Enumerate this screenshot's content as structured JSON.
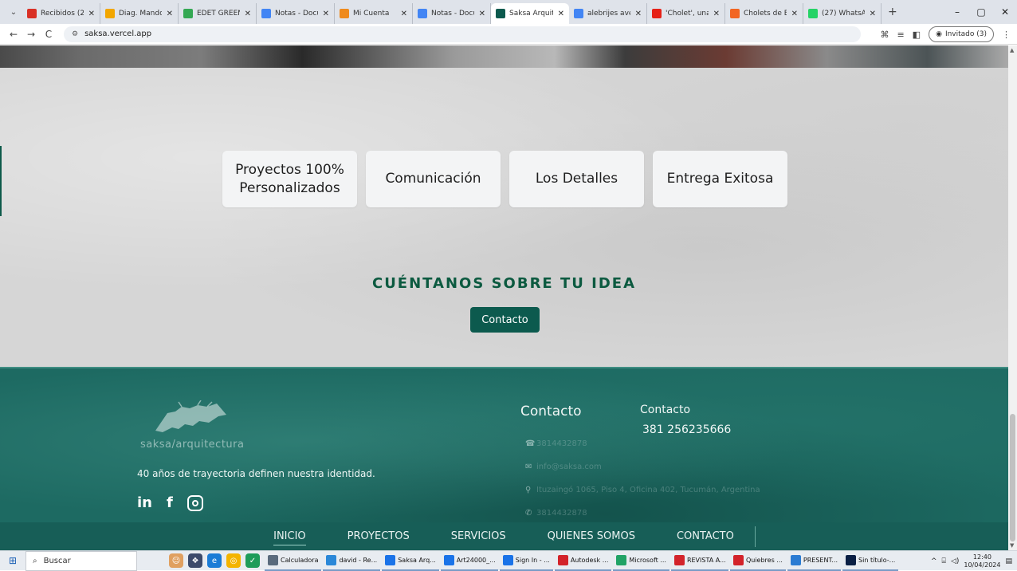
{
  "browser": {
    "tabs": [
      {
        "title": "Recibidos (2)",
        "favicon_color": "#d93025"
      },
      {
        "title": "Diag. Mandoq",
        "favicon_color": "#f2a600"
      },
      {
        "title": "EDET GREEN",
        "favicon_color": "#34a853"
      },
      {
        "title": "Notas - Docum",
        "favicon_color": "#4285f4"
      },
      {
        "title": "Mi Cuenta",
        "favicon_color": "#ef8a1c"
      },
      {
        "title": "Notas - Docum",
        "favicon_color": "#4285f4"
      },
      {
        "title": "Saksa Arquitec",
        "favicon_color": "#0c5a4e",
        "active": true
      },
      {
        "title": "alebrijes aveni",
        "favicon_color": "#4285f4"
      },
      {
        "title": "'Cholet', una m",
        "favicon_color": "#e62117"
      },
      {
        "title": "Cholets de El A",
        "favicon_color": "#f26522"
      },
      {
        "title": "(27) WhatsApp",
        "favicon_color": "#25d366"
      }
    ],
    "new_tab_symbol": "+",
    "window_controls": {
      "minimize": "–",
      "maximize": "▢",
      "close": "✕"
    },
    "nav": {
      "back": "←",
      "forward": "→",
      "reload": "C"
    },
    "url": "saksa.vercel.app",
    "profile_label": "Invitado (3)"
  },
  "page": {
    "features": [
      "Proyectos 100% Personalizados",
      "Comunicación",
      "Los Detalles",
      "Entrega Exitosa"
    ],
    "cta_title": "CUÉNTANOS SOBRE TU IDEA",
    "cta_button": "Contacto",
    "footer": {
      "logo_text": "saksa/arquitectura",
      "tagline": "40 años de trayectoria definen nuestra identidad.",
      "social": [
        "linkedin-icon",
        "facebook-icon",
        "instagram-icon"
      ],
      "social_labels": {
        "linkedin": "in",
        "facebook": "f"
      },
      "contact_heading": "Contacto",
      "contact_items": [
        {
          "icon": "phone-icon",
          "glyph": "☎",
          "text": "3814432878"
        },
        {
          "icon": "mail-icon",
          "glyph": "✉",
          "text": "info@saksa.com"
        },
        {
          "icon": "location-icon",
          "glyph": "⚲",
          "text": "Ituzaingó 1065, Piso 4, Oficina 402, Tucumán, Argentina"
        },
        {
          "icon": "whatsapp-icon",
          "glyph": "✆",
          "text": "3814432878"
        }
      ],
      "contact_heading_2": "Contacto",
      "contact_phone": "381 256235666",
      "nav": [
        "INICIO",
        "PROYECTOS",
        "SERVICIOS",
        "QUIENES SOMOS",
        "CONTACTO"
      ],
      "nav_active": "INICIO"
    }
  },
  "taskbar": {
    "start_icon": "⊞",
    "search_placeholder": "Buscar",
    "apps": [
      {
        "label": "Calculadora",
        "color": "#5a6b7d"
      },
      {
        "label": "david - Re...",
        "color": "#2b88d8"
      },
      {
        "label": "Saksa Arq...",
        "color": "#1a73e8"
      },
      {
        "label": "Art24000_...",
        "color": "#1a73e8"
      },
      {
        "label": "Sign In - ...",
        "color": "#1a73e8"
      },
      {
        "label": "Autodesk ...",
        "color": "#d3232a"
      },
      {
        "label": "Microsoft ...",
        "color": "#21a366"
      },
      {
        "label": "REVISTA A...",
        "color": "#d3232a"
      },
      {
        "label": "Quiebres ...",
        "color": "#d3232a"
      },
      {
        "label": "PRESENT...",
        "color": "#2b7cd3"
      },
      {
        "label": "Sin título-...",
        "color": "#0a1f44"
      }
    ],
    "time": "12:40",
    "date": "10/04/2024"
  }
}
